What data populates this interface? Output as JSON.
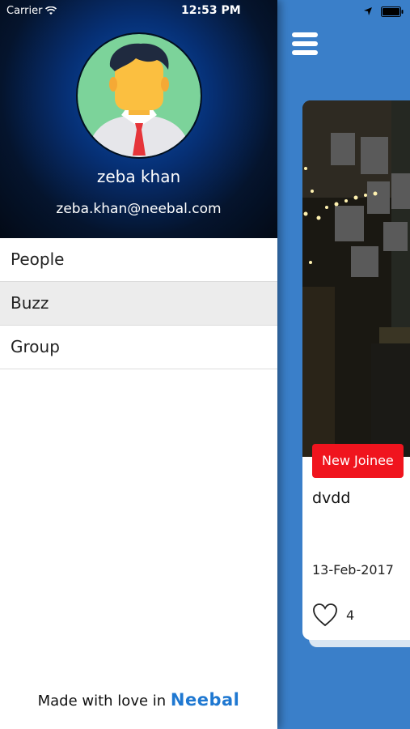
{
  "status_bar": {
    "carrier": "Carrier",
    "time": "12:53 PM",
    "icons": [
      "wifi-icon",
      "location-arrow-icon",
      "battery-icon"
    ]
  },
  "drawer": {
    "user": {
      "name": "zeba khan",
      "email": "zeba.khan@neebal.com",
      "avatar_icon": "user-avatar-icon"
    },
    "menu": [
      {
        "label": "People",
        "active": false
      },
      {
        "label": "Buzz",
        "active": true
      },
      {
        "label": "Group",
        "active": false
      }
    ],
    "footer": {
      "text": "Made with love in",
      "brand": "Neebal"
    }
  },
  "main": {
    "menu_icon": "hamburger-menu-icon",
    "card": {
      "tag": "New Joinee",
      "title": "dvdd",
      "date": "13-Feb-2017",
      "likes": "4",
      "like_icon": "heart-outline-icon"
    }
  },
  "colors": {
    "main_background": "#3a7fc9",
    "drawer_header": "#062f73",
    "tag_red": "#f0141e",
    "brand_blue": "#1f78d1",
    "active_item": "#ececec"
  }
}
